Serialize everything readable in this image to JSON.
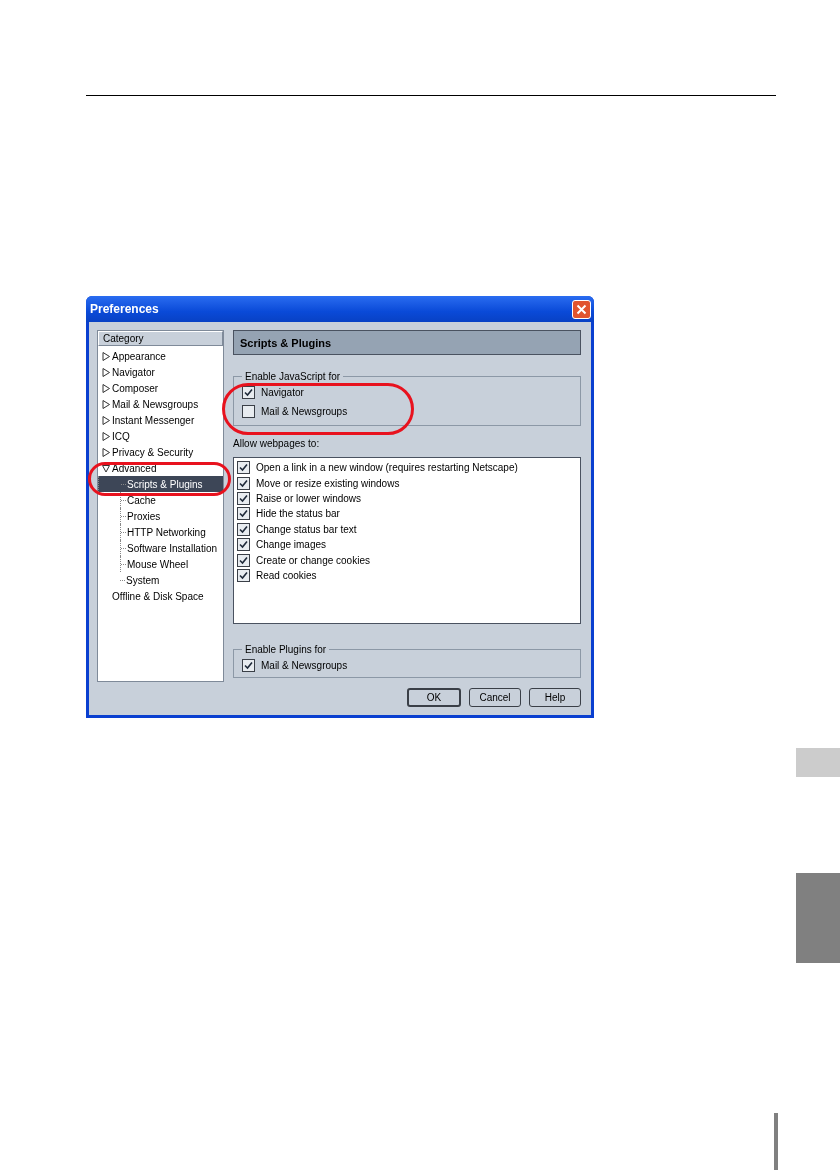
{
  "window": {
    "title": "Preferences"
  },
  "category": {
    "header": "Category",
    "items": [
      {
        "label": "Appearance",
        "kind": "folder",
        "expanded": false,
        "selected": false
      },
      {
        "label": "Navigator",
        "kind": "folder",
        "expanded": false,
        "selected": false
      },
      {
        "label": "Composer",
        "kind": "folder",
        "expanded": false,
        "selected": false
      },
      {
        "label": "Mail & Newsgroups",
        "kind": "folder",
        "expanded": false,
        "selected": false
      },
      {
        "label": "Instant Messenger",
        "kind": "folder",
        "expanded": false,
        "selected": false
      },
      {
        "label": "ICQ",
        "kind": "folder",
        "expanded": false,
        "selected": false
      },
      {
        "label": "Privacy & Security",
        "kind": "folder",
        "expanded": false,
        "selected": false
      },
      {
        "label": "Advanced",
        "kind": "folder",
        "expanded": true,
        "selected": false,
        "children": [
          {
            "label": "Scripts & Plugins",
            "selected": true
          },
          {
            "label": "Cache",
            "selected": false
          },
          {
            "label": "Proxies",
            "selected": false
          },
          {
            "label": "HTTP Networking",
            "selected": false
          },
          {
            "label": "Software Installation",
            "selected": false
          },
          {
            "label": "Mouse Wheel",
            "selected": false
          },
          {
            "label": "System",
            "selected": false
          }
        ]
      },
      {
        "label": "Offline & Disk Space",
        "kind": "leaf",
        "selected": false
      }
    ]
  },
  "panel": {
    "title": "Scripts & Plugins",
    "javascript": {
      "legend": "Enable JavaScript for",
      "options": [
        {
          "label": "Navigator",
          "checked": true
        },
        {
          "label": "Mail & Newsgroups",
          "checked": false
        }
      ]
    },
    "allow_label": "Allow webpages to:",
    "permissions": [
      {
        "label": "Open a link in a new window (requires restarting Netscape)",
        "checked": true
      },
      {
        "label": "Move or resize existing windows",
        "checked": true
      },
      {
        "label": "Raise or lower windows",
        "checked": true
      },
      {
        "label": "Hide the status bar",
        "checked": true
      },
      {
        "label": "Change status bar text",
        "checked": true
      },
      {
        "label": "Change images",
        "checked": true
      },
      {
        "label": "Create or change cookies",
        "checked": true
      },
      {
        "label": "Read cookies",
        "checked": true
      }
    ],
    "plugins": {
      "legend": "Enable Plugins for",
      "options": [
        {
          "label": "Mail & Newsgroups",
          "checked": true
        }
      ]
    }
  },
  "buttons": [
    {
      "label": "OK",
      "default": true
    },
    {
      "label": "Cancel",
      "default": false
    },
    {
      "label": "Help",
      "default": false
    }
  ]
}
